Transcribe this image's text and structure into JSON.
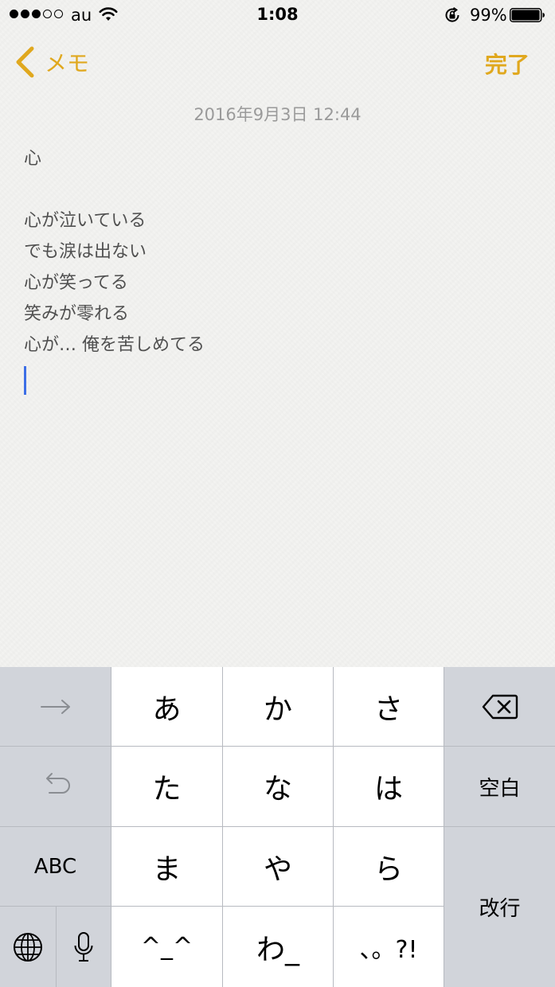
{
  "status_bar": {
    "carrier": "au",
    "time": "1:08",
    "battery_percent": "99%",
    "signal_bars_filled": 3,
    "signal_bars_total": 5,
    "battery_level": 0.99
  },
  "nav": {
    "back_label": "メモ",
    "done_label": "完了",
    "accent_color": "#e0a81e"
  },
  "note": {
    "date": "2016年9月3日 12:44",
    "lines": [
      "心",
      "",
      "心が泣いている",
      "でも涙は出ない",
      "心が笑ってる",
      "笑みが零れる",
      "心が… 俺を苦しめてる"
    ],
    "cursor_color": "#3d6fe6"
  },
  "keyboard": {
    "next_icon": "arrow-right-icon",
    "undo_icon": "undo-icon",
    "abc_label": "ABC",
    "globe_icon": "globe-icon",
    "mic_icon": "microphone-icon",
    "backspace_icon": "backspace-icon",
    "space_label": "空白",
    "return_label": "改行",
    "kana": {
      "a": "あ",
      "ka": "か",
      "sa": "さ",
      "ta": "た",
      "na": "な",
      "ha": "は",
      "ma": "ま",
      "ya": "や",
      "ra": "ら",
      "emoticon": "^_^",
      "wa": "わ_",
      "punct": "、。?!"
    }
  }
}
